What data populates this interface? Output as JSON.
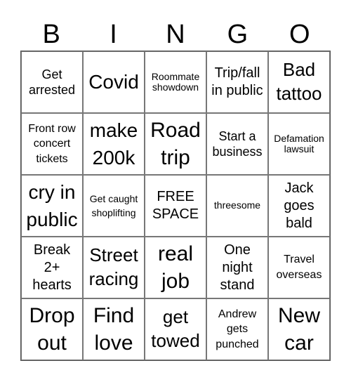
{
  "header": {
    "letters": [
      "B",
      "I",
      "N",
      "G",
      "O"
    ]
  },
  "cells": [
    [
      "Get arrested",
      "Covid",
      "Roommate showdown",
      "Trip/fall in public",
      "Bad tattoo"
    ],
    [
      "Front row concert tickets",
      "make 200k",
      "Road trip",
      "Start a business",
      "Defamation lawsuit"
    ],
    [
      "cry in public",
      "Get caught shoplifting",
      "FREE SPACE",
      "threesome",
      "Jack goes bald"
    ],
    [
      "Break 2+ hearts",
      "Street racing",
      "real job",
      "One night stand",
      "Travel overseas"
    ],
    [
      "Drop out",
      "Find love",
      "get towed",
      "Andrew gets punched",
      "New car"
    ]
  ]
}
